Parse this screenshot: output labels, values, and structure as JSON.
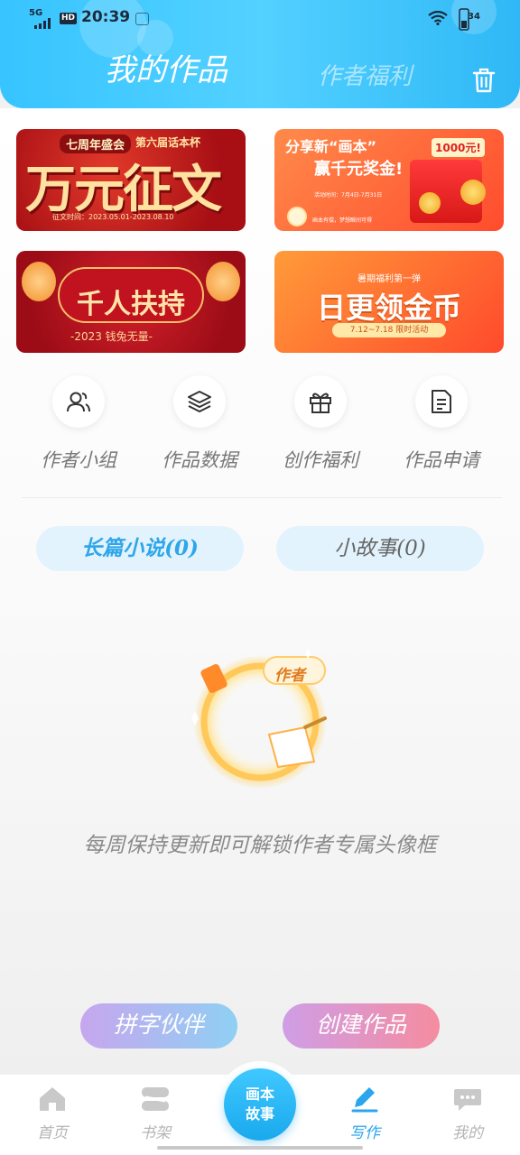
{
  "status_bar": {
    "network": "5G",
    "hd": "HD",
    "time": "20:39",
    "battery": "34"
  },
  "header": {
    "tab_mine": "我的作品",
    "tab_welfare": "作者福利"
  },
  "banners": {
    "b1": {
      "head": "七周年盛会",
      "cup": "第六届话本杯",
      "big": "万元征文",
      "date": "征文时间：2023.05.01-2023.08.10"
    },
    "b2": {
      "line1": "分享新“画本”",
      "line2": "赢千元奖金!",
      "tag": "1000元!",
      "small": "活动时间：7月4日-7月31日",
      "foot": "画本有偿，梦想瞬间可得"
    },
    "b3": {
      "big": "千人扶持",
      "sub": "-2023 钱兔无量-"
    },
    "b4": {
      "top": "暑期福利第一弹",
      "big": "日更领金币",
      "pill": "7.12~7.18 限时活动"
    }
  },
  "quick": [
    {
      "label": "作者小组",
      "icon": "group-icon"
    },
    {
      "label": "作品数据",
      "icon": "layers-icon"
    },
    {
      "label": "创作福利",
      "icon": "gift-icon"
    },
    {
      "label": "作品申请",
      "icon": "document-icon"
    }
  ],
  "tabs": {
    "long": "长篇小说(0)",
    "short": "小故事(0)"
  },
  "empty": {
    "badge": "作者",
    "text": "每周保持更新即可解锁作者专属头像框"
  },
  "buttons": {
    "partner": "拼字伙伴",
    "create": "创建作品"
  },
  "nav": {
    "home": "首页",
    "shelf": "书架",
    "center_line1": "画本",
    "center_line2": "故事",
    "write": "写作",
    "mine": "我的",
    "active_color": "#2aa5ee",
    "inactive_color": "#b5b5b5"
  },
  "colors": {
    "header_blue": "#37c4ff",
    "accent": "#2ea6ea"
  }
}
